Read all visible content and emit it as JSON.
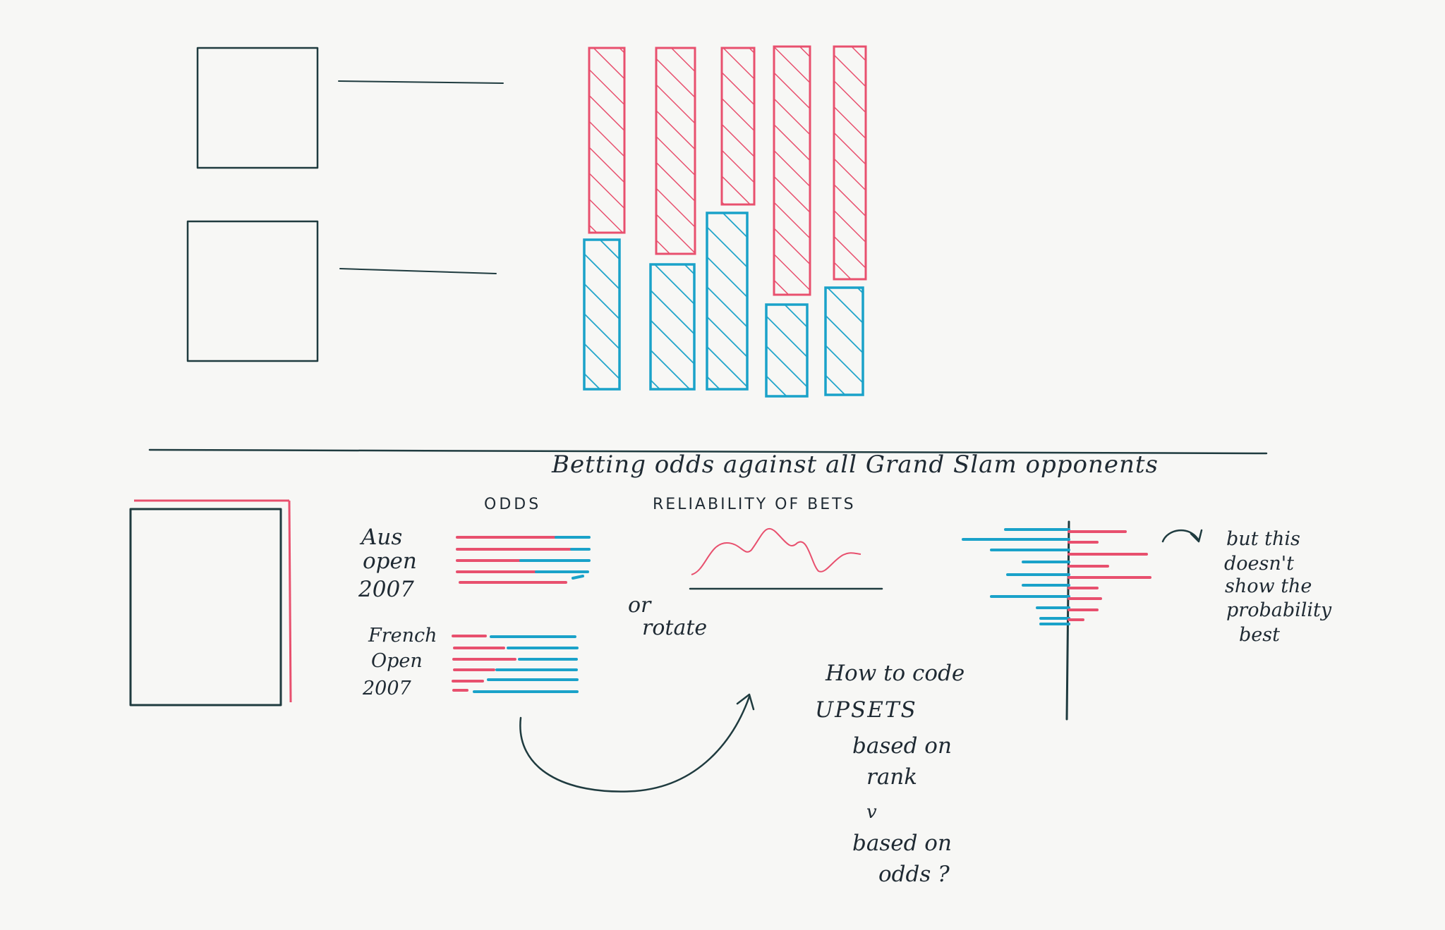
{
  "colors": {
    "paper": "#f7f7f5",
    "ink": "#1f3b3f",
    "pink": "#e8506e",
    "blue": "#1aa2c9"
  },
  "title": "Betting odds against all Grand Slam opponents",
  "odds_heading": "ODDS",
  "reliability_heading": "RELIABILITY OF BETS",
  "tournaments": {
    "aus": [
      "Aus",
      "open",
      "2007"
    ],
    "french": [
      "French",
      "Open",
      "2007"
    ]
  },
  "or_rotate": [
    "or",
    "rotate"
  ],
  "note_probability": [
    "but this",
    "doesn't",
    "show the",
    "probability",
    "best"
  ],
  "upsets_note": [
    "How to code",
    "UPSETS",
    "based on",
    "rank",
    "v",
    "based on",
    "odds ?"
  ]
}
